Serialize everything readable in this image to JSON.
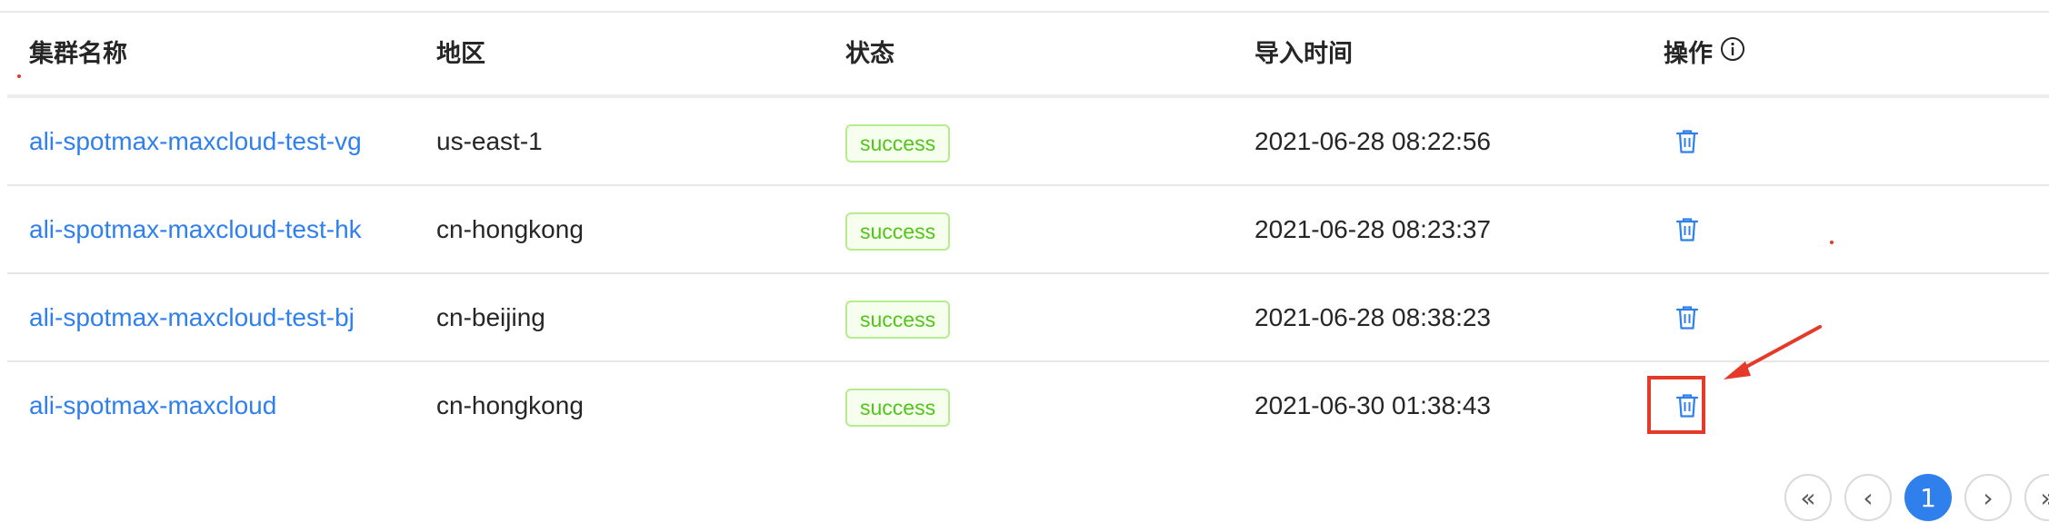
{
  "table": {
    "headers": {
      "name": "集群名称",
      "region": "地区",
      "status": "状态",
      "import_time": "导入时间",
      "actions": "操作"
    },
    "rows": [
      {
        "name": "ali-spotmax-maxcloud-test-vg",
        "region": "us-east-1",
        "status": "success",
        "import_time": "2021-06-28 08:22:56",
        "action_icon": "trash-icon"
      },
      {
        "name": "ali-spotmax-maxcloud-test-hk",
        "region": "cn-hongkong",
        "status": "success",
        "import_time": "2021-06-28 08:23:37",
        "action_icon": "trash-icon"
      },
      {
        "name": "ali-spotmax-maxcloud-test-bj",
        "region": "cn-beijing",
        "status": "success",
        "import_time": "2021-06-28 08:38:23",
        "action_icon": "trash-icon"
      },
      {
        "name": "ali-spotmax-maxcloud",
        "region": "cn-hongkong",
        "status": "success",
        "import_time": "2021-06-30 01:38:43",
        "action_icon": "trash-icon"
      }
    ]
  },
  "pagination": {
    "first": "«",
    "prev": "‹",
    "current": "1",
    "next": "›",
    "last": "»"
  },
  "colors": {
    "link": "#2f80ed",
    "status_success_text": "#52c41a",
    "status_success_border": "#b7eb8f",
    "status_success_bg": "#f6ffed",
    "annotation_red": "#e5392a",
    "active_page": "#2f80ed"
  }
}
